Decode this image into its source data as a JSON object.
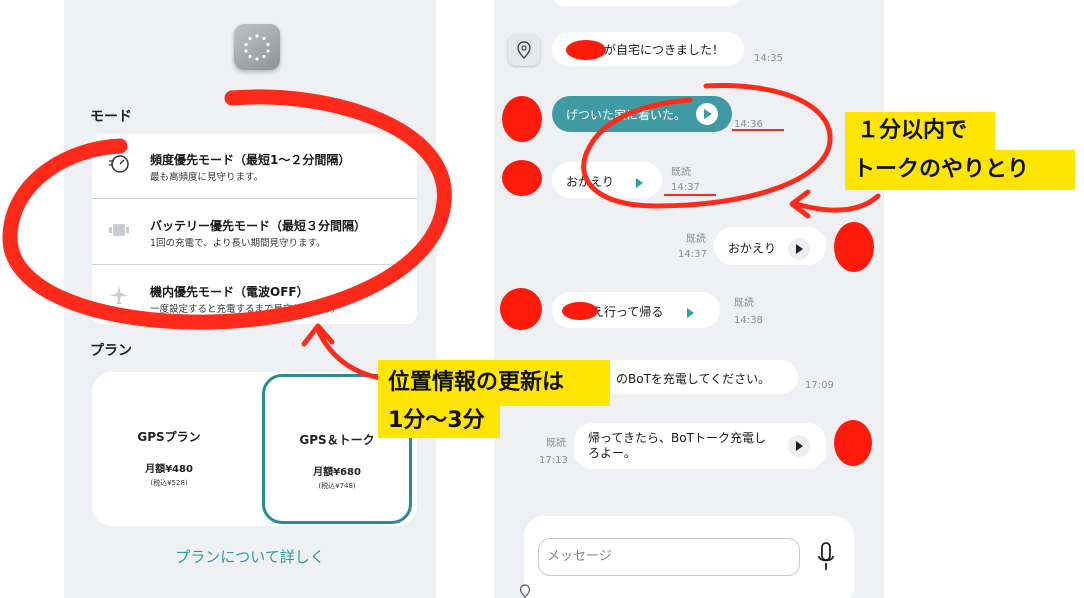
{
  "left": {
    "mode_title": "モード",
    "modes": [
      {
        "name": "頻度優先モード（最短1〜２分間隔）",
        "desc": "最も高頻度に見守ります。",
        "icon": "timer-icon"
      },
      {
        "name": "バッテリー優先モード（最短３分間隔）",
        "desc": "1回の充電で、より長い期間見守ります。",
        "icon": "battery-icon"
      },
      {
        "name": "機内優先モード（電波OFF）",
        "desc": "一度設定すると充電するまで見守りません。",
        "icon": "airplane-icon"
      }
    ],
    "plan_title": "プラン",
    "plans": [
      {
        "name": "GPSプラン",
        "price": "月額¥480",
        "tax": "(税込¥528)"
      },
      {
        "name": "GPS＆トーク",
        "price": "月額¥680",
        "tax": "(税込¥748)"
      }
    ],
    "plan_link": "プランについて詳しく"
  },
  "chat": {
    "messages": [
      {
        "text": "が自宅につきました！",
        "time": "14:35"
      },
      {
        "text": "げついた家に着いた。",
        "time": "14:36"
      },
      {
        "text": "おかえり",
        "read": "既読",
        "time": "14:37"
      },
      {
        "text": "おかえり",
        "read": "既読",
        "time": "14:37"
      },
      {
        "text": "迎え行って帰る",
        "read": "既読",
        "time": "14:38"
      },
      {
        "text": "」のBoTを充電してください。",
        "time": "17:09"
      },
      {
        "text": "帰ってきたら、BoTトーク充電しろよー。",
        "text_line1": "帰ってきたら、BoTトーク充電し",
        "text_line2": "ろよー。",
        "read": "既読",
        "time": "17:13"
      }
    ],
    "input_placeholder": "メッセージ"
  },
  "annotations": {
    "right_callout_line1": "１分以内で",
    "right_callout_line2": "トークのやりとり",
    "left_callout_line1": "位置情報の更新は",
    "left_callout_line2": "1分〜3分"
  },
  "colors": {
    "accent": "#2a9aa8",
    "highlight": "#ffe500",
    "marker": "#ff2a1a",
    "background": "#eef0f4"
  }
}
